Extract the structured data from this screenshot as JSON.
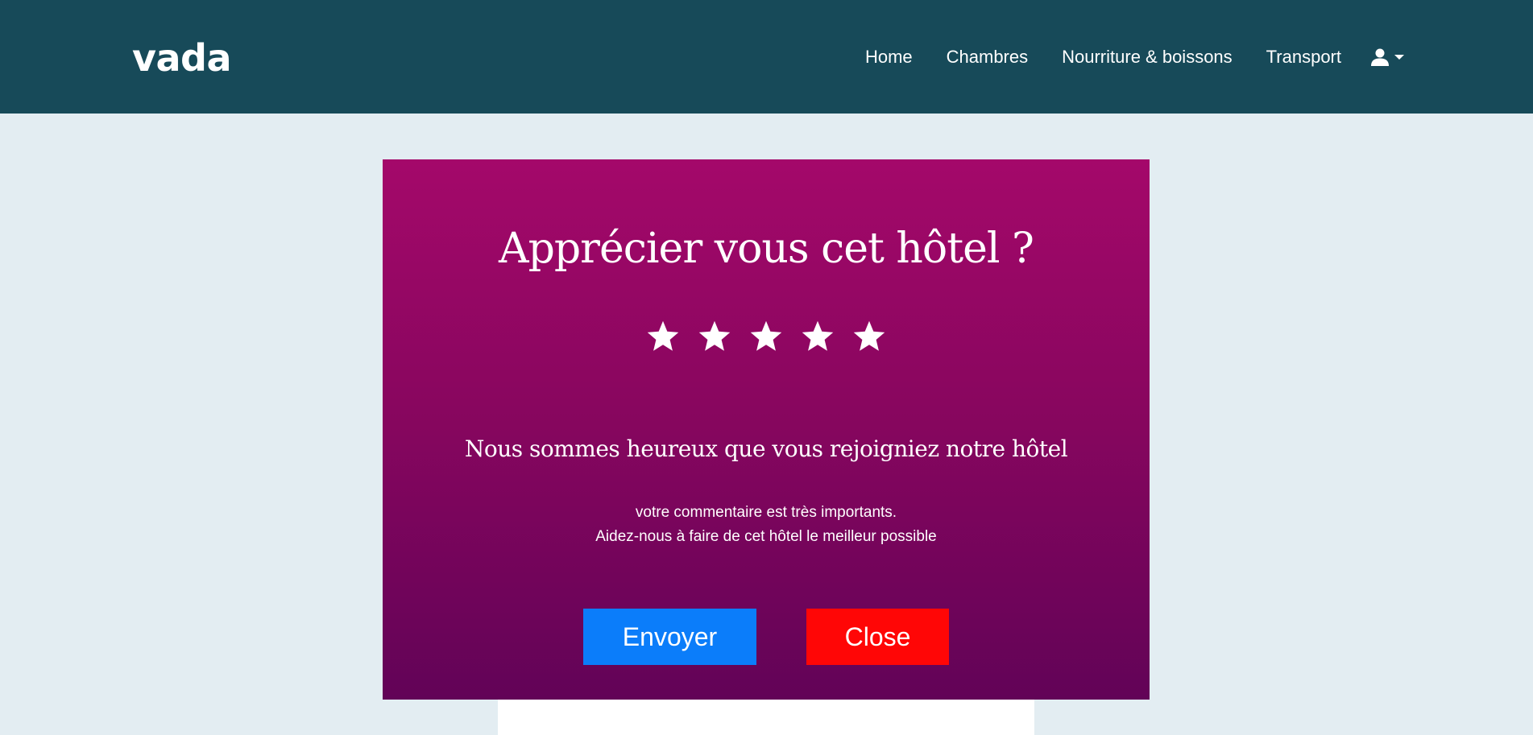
{
  "navbar": {
    "brand": "vada",
    "links": [
      "Home",
      "Chambres",
      "Nourriture & boissons",
      "Transport"
    ],
    "user_icon": "user-icon",
    "caret_icon": "caret-down-icon",
    "background": "#174a59"
  },
  "modal": {
    "title": "Apprécier vous cet hôtel ?",
    "rating": {
      "max": 5,
      "icon": "star-icon"
    },
    "subtitle": "Nous sommes heureux que vous rejoigniez notre hôtel",
    "text_line1": "votre commentaire est très importants.",
    "text_line2": "Aidez-nous à faire de cet hôtel le meilleur possible",
    "send_label": "Envoyer",
    "close_label": "Close",
    "colors": {
      "gradient_top": "#a4086a",
      "gradient_bottom": "#620357",
      "send": "#0b7dfa",
      "close": "#ff0606"
    }
  }
}
